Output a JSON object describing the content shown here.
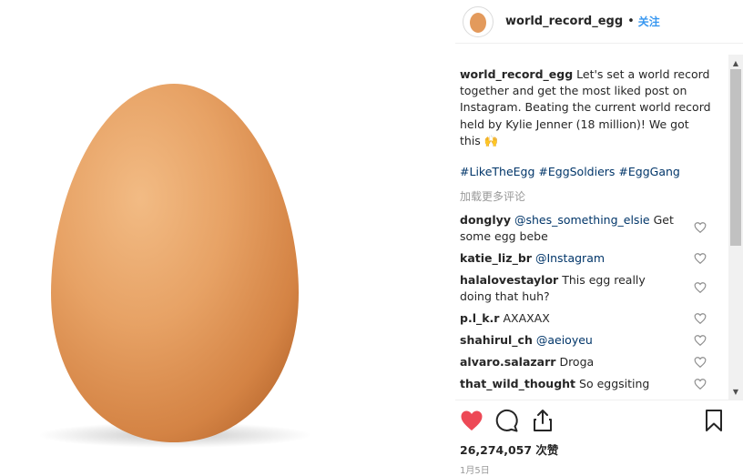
{
  "post": {
    "username": "world_record_egg",
    "dot": "•",
    "follow_label": "关注",
    "caption_user": "world_record_egg",
    "caption_text": "Let's set a world record together and get the most liked post on Instagram. Beating the current world record held by Kylie Jenner (18 million)! We got this 🙌",
    "hashtags": "#LikeTheEgg #EggSoldiers #EggGang",
    "load_more": "加载更多评论",
    "likes": "26,274,057 次赞",
    "date": "1月5日"
  },
  "comments": [
    {
      "user": "donglyy",
      "mention": "@shes_something_elsie",
      "text": " Get some egg bebe"
    },
    {
      "user": "katie_liz_br",
      "mention": "@Instagram",
      "text": ""
    },
    {
      "user": "halalovestaylor",
      "mention": "",
      "text": "This egg really doing that huh?"
    },
    {
      "user": "p.l_k.r",
      "mention": "",
      "text": "AXAXAX"
    },
    {
      "user": "shahirul_ch",
      "mention": "@aeioyeu",
      "text": ""
    },
    {
      "user": "alvaro.salazarr",
      "mention": "",
      "text": "Droga"
    },
    {
      "user": "that_wild_thought",
      "mention": "",
      "text": "So eggsiting"
    }
  ],
  "icons": {
    "heart": "heart-icon",
    "comment": "comment-icon",
    "share": "share-icon",
    "bookmark": "bookmark-icon"
  },
  "colors": {
    "like_red": "#ed4956",
    "link_blue": "#3897f0",
    "hashtag": "#003569",
    "egg": "#e39a5c"
  }
}
